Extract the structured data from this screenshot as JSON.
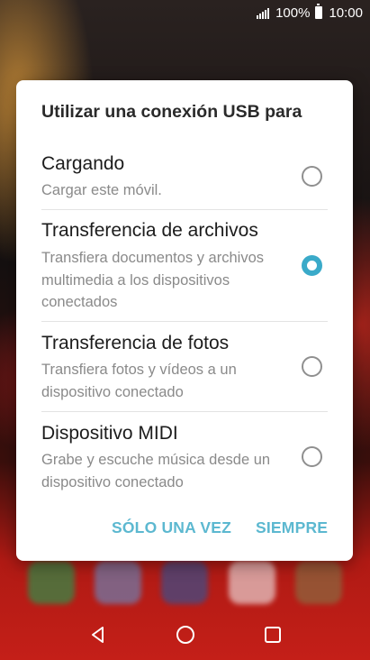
{
  "status_bar": {
    "battery_percent": "100%",
    "time": "10:00"
  },
  "dialog": {
    "title": "Utilizar una conexión USB para",
    "options": [
      {
        "title": "Cargando",
        "description": "Cargar este móvil.",
        "selected": false
      },
      {
        "title": "Transferencia de archivos",
        "description": "Transfiera documentos y archivos multimedia a los dispositivos conectados",
        "selected": true
      },
      {
        "title": "Transferencia de fotos",
        "description": "Transfiera fotos y vídeos a un dispositivo conectado",
        "selected": false
      },
      {
        "title": "Dispositivo MIDI",
        "description": "Grabe y escuche música desde un dispositivo conectado",
        "selected": false
      }
    ],
    "buttons": {
      "once": "SÓLO UNA VEZ",
      "always": "SIEMPRE"
    }
  },
  "colors": {
    "accent": "#3aaac9",
    "button_text": "#5cb8d0"
  },
  "icons": {
    "signal": "signal-icon",
    "battery": "battery-icon",
    "back": "back-icon",
    "home": "home-icon",
    "recents": "recents-icon"
  }
}
